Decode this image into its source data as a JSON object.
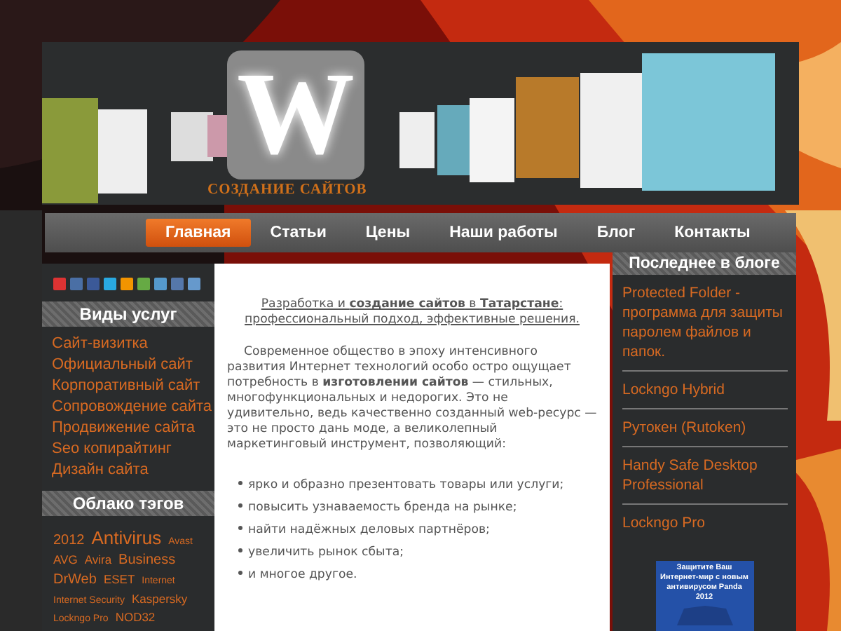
{
  "header": {
    "logo_letter": "W",
    "tagline": "СОЗДАНИЕ САЙТОВ"
  },
  "nav": [
    {
      "label": "Главная",
      "selected": true
    },
    {
      "label": "Статьи",
      "selected": false
    },
    {
      "label": "Цены",
      "selected": false
    },
    {
      "label": "Наши работы",
      "selected": false
    },
    {
      "label": "Блог",
      "selected": false
    },
    {
      "label": "Контакты",
      "selected": false
    }
  ],
  "left": {
    "services": {
      "title": "Виды услуг",
      "items": [
        "Сайт-визитка",
        "Официальный сайт",
        "Корпоративный сайт",
        "Сопровождение сайта",
        "Продвижение сайта",
        "Seo копирайтинг",
        "Дизайн сайта"
      ]
    },
    "tags": {
      "title": "Облако тэгов",
      "items": [
        {
          "label": "2012",
          "kind": "m"
        },
        {
          "label": "Antivirus",
          "kind": "xl"
        },
        {
          "label": "Avast",
          "kind": "xs"
        },
        {
          "label": "AVG",
          "kind": "s"
        },
        {
          "label": "Avira",
          "kind": "s"
        },
        {
          "label": "Business",
          "kind": "m"
        },
        {
          "label": "DrWeb",
          "kind": "m"
        },
        {
          "label": "ESET",
          "kind": "s"
        },
        {
          "label": "Internet",
          "kind": "xs"
        },
        {
          "label": "Internet Security",
          "kind": "xs"
        },
        {
          "label": "Kaspersky",
          "kind": "s"
        },
        {
          "label": "Lockngo Pro",
          "kind": "xs"
        },
        {
          "label": "NOD32",
          "kind": "s"
        }
      ]
    }
  },
  "main": {
    "heading": "Разработка и **создание сайтов** в **Татарстане**: профессиональный подход, эффективные решения.",
    "paragraph": "Современное общество в эпоху интенсивного развития Интернет технологий особо остро ощущает потребность в **изготовлении сайтов** — стильных, многофункциональных и недорогих. Это не удивительно, ведь качественно созданный web-ресурс — это не просто дань моде, а великолепный маркетинговый инструмент, позволяющий:",
    "bullets": [
      "ярко и образно презентовать товары или услуги;",
      "повысить узнаваемость бренда на рынке;",
      "найти надёжных деловых партнёров;",
      "увеличить рынок сбыта;",
      "и многое другое."
    ]
  },
  "right": {
    "title": "Последнее в блоге",
    "posts": [
      "Protected Folder - программа для защиты паролем файлов и папок.",
      "Lockngo Hybrid",
      "Рутокен (Rutoken)",
      "Handy Safe Desktop Professional",
      "Lockngo Pro"
    ],
    "banner": "Защитите Ваш Интернет-мир с новым антивирусом Panda 2012"
  }
}
